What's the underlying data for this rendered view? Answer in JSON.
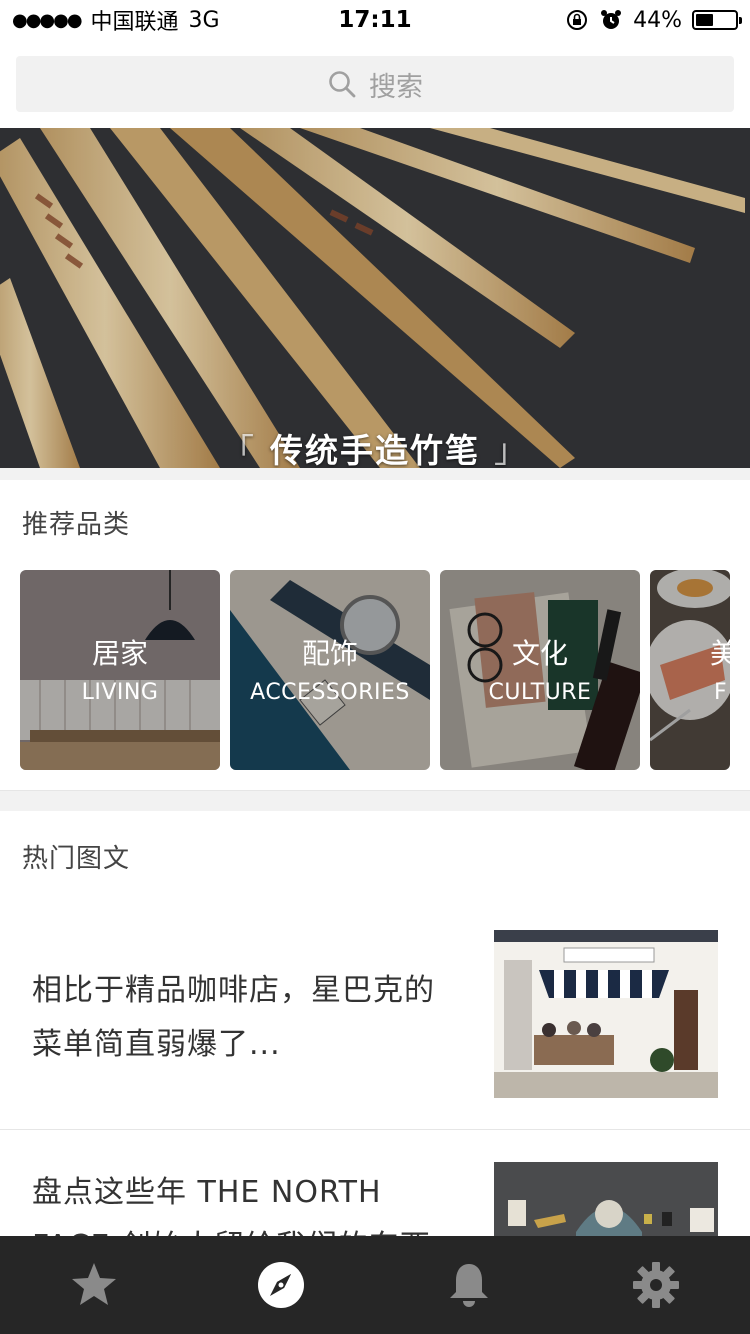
{
  "status": {
    "signal_dots": "●●●●●",
    "carrier": "中国联通",
    "network": "3G",
    "time": "17:11",
    "battery_percent": "44%",
    "battery_level": 0.44
  },
  "search": {
    "placeholder": "搜索",
    "icon": "search-icon"
  },
  "banner": {
    "title": "传统手造竹笔",
    "open_bracket": "「",
    "close_bracket": "」"
  },
  "categories": {
    "heading": "推荐品类",
    "items": [
      {
        "cn": "居家",
        "en": "LIVING"
      },
      {
        "cn": "配饰",
        "en": "ACCESSORIES"
      },
      {
        "cn": "文化",
        "en": "CULTURE"
      },
      {
        "cn": "美",
        "en": "F"
      }
    ]
  },
  "articles": {
    "heading": "热门图文",
    "items": [
      {
        "title": "相比于精品咖啡店，星巴克的菜单简直弱爆了..."
      },
      {
        "title": "盘点这些年 THE NORTH FACE 创始人留给我们的东西"
      }
    ]
  },
  "tabbar": {
    "items": [
      {
        "icon": "star-icon"
      },
      {
        "icon": "compass-icon",
        "active": true
      },
      {
        "icon": "bell-icon"
      },
      {
        "icon": "gear-icon"
      }
    ]
  },
  "colors": {
    "tabbar_bg": "#262626",
    "tab_icon": "#8a8a8a",
    "tab_active": "#ffffff",
    "section_band": "#f2f2f2"
  }
}
